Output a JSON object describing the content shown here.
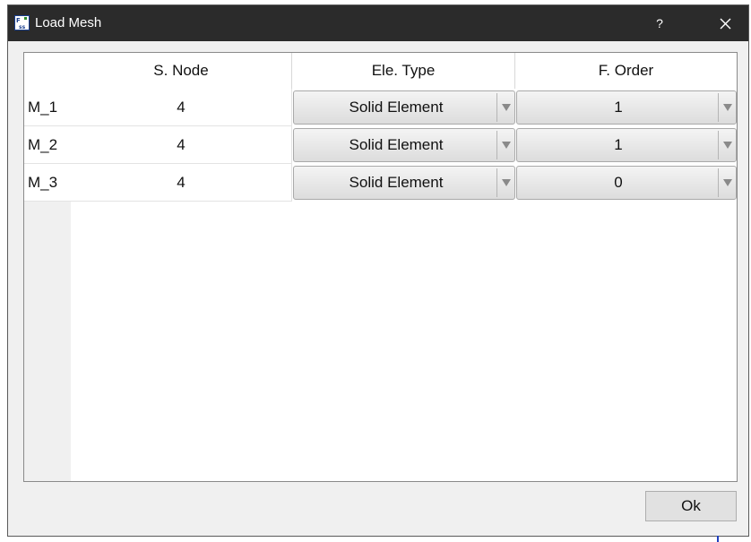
{
  "window": {
    "title": "Load Mesh",
    "help_label": "?",
    "app_icon": "fss-app-icon"
  },
  "table": {
    "columns": [
      "S. Node",
      "Ele. Type",
      "F. Order"
    ],
    "rows": [
      {
        "label": "M_1",
        "s_node": "4",
        "ele_type": "Solid Element",
        "f_order": "1"
      },
      {
        "label": "M_2",
        "s_node": "4",
        "ele_type": "Solid Element",
        "f_order": "1"
      },
      {
        "label": "M_3",
        "s_node": "4",
        "ele_type": "Solid Element",
        "f_order": "0"
      }
    ]
  },
  "buttons": {
    "ok_label": "Ok"
  },
  "colors": {
    "titlebar": "#2b2b2b",
    "dialog_bg": "#f0f0f0",
    "table_bg": "#ffffff"
  }
}
